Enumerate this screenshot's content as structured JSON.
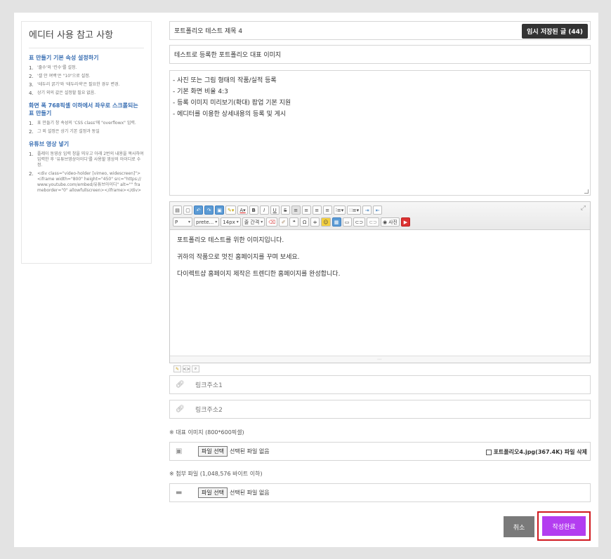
{
  "sidebar": {
    "title": "에디터 사용 참고 사항",
    "sections": [
      {
        "heading": "표 만들기 기본 속성 설정하기",
        "items": [
          "'줄수'와 '칸수'를 설정.",
          "'셀 안 여백'은 \"10\"으로 설정.",
          "'테두리 굵기'와 '테두리색'은 필요한 경우 변경.",
          "상기 외의 값은 설정할 필요 없음."
        ]
      },
      {
        "heading": "화면 폭 768픽셀 이하에서 좌우로 스크롤되는 표 만들기",
        "items": [
          "표 만들기 창 속성의 'CSS class'에 \"overflowx\" 입력.",
          "그 외 설정은 상기 기본 설정과 동일"
        ]
      },
      {
        "heading": "유튜브 영상 넣기",
        "items": [
          "플레이 동영상 입력 창을 띄우고 아래 2번의 내용을 복사하여 입력한 후 '유튜브영상아이디'를 사용할 영상의 아이디로 수정.",
          "<div class=\"video-holder [vimeo, widescreen]\"><iframe width=\"800\" height=\"450\" src=\"https://www.youtube.com/embed/유튜브아이디\" alt=\"\" frameborder=\"0\" allowfullscreen></iframe></div>"
        ]
      }
    ]
  },
  "form": {
    "title_value": "포트폴리오 테스트 제목 4",
    "draft_button": "임시 저장된 글 (44)",
    "subtitle_value": "테스트로 등록한 포트폴리오 대표 이미지",
    "summary_lines": [
      "- 사진 또는 그림 형태의 작품/실적 등록",
      "- 기본 화면 비율 4:3",
      "- 등록 이미지 미리보기(확대) 팝업 기본 지원",
      "- 에디터를 이용한 상세내용의 등록 및 게시"
    ],
    "toolbar": {
      "format_select": "P",
      "font_select": "prete...",
      "size_select": "14px",
      "lineheight_select": "줄 간격",
      "photo_label": "사진"
    },
    "editor_paragraphs": [
      "포트폴리오 테스트를 위한 이미지입니다.",
      "귀하의 작품으로 멋진 홈페이지를 꾸며 보세요.",
      "다이렉트샵 홈페이지 제작은 트렌디한 홈페이지를 완성합니다."
    ],
    "link1_placeholder": "링크주소1",
    "link2_placeholder": "링크주소2",
    "image_label": "※ 대표 이미지 (800*600픽셀)",
    "file_button": "파일 선택",
    "file_none": "선택된 파일 없음",
    "image_delete": "포트폴리오4.jpg(367.4K) 파일 삭제",
    "attach_label": "※ 첨부 파일 (1,048,576 바이트 이하)",
    "cancel_button": "취소",
    "submit_button": "작성완료"
  },
  "colors": {
    "accent_submit": "#b33df0",
    "highlight_border": "#d0181f",
    "sidebar_heading": "#3a6fb3"
  }
}
